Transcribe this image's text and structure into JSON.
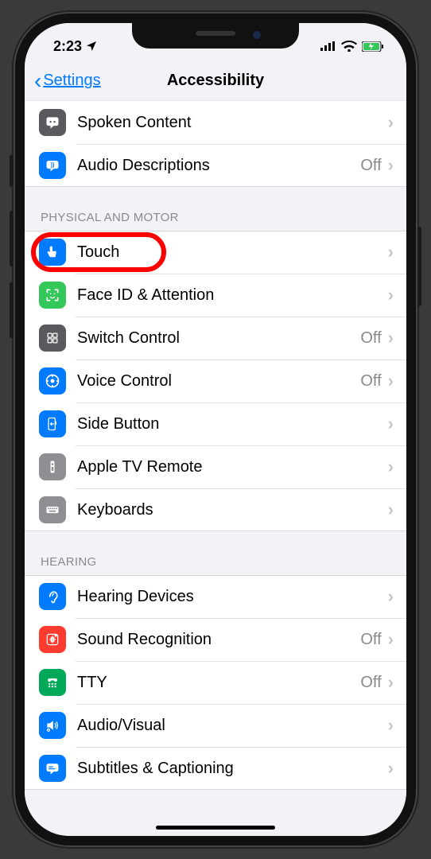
{
  "status": {
    "time": "2:23"
  },
  "nav": {
    "back": "Settings",
    "title": "Accessibility"
  },
  "sections": [
    {
      "header": null,
      "rows": [
        {
          "icon": "speech-icon",
          "bg": "bg-gray-dark",
          "label": "Spoken Content",
          "value": ""
        },
        {
          "icon": "audio-desc-icon",
          "bg": "bg-blue",
          "label": "Audio Descriptions",
          "value": "Off"
        }
      ]
    },
    {
      "header": "PHYSICAL AND MOTOR",
      "rows": [
        {
          "icon": "touch-icon",
          "bg": "bg-blue",
          "label": "Touch",
          "value": "",
          "highlight": true
        },
        {
          "icon": "faceid-icon",
          "bg": "bg-green",
          "label": "Face ID & Attention",
          "value": ""
        },
        {
          "icon": "switch-icon",
          "bg": "bg-gray-dark",
          "label": "Switch Control",
          "value": "Off"
        },
        {
          "icon": "voice-icon",
          "bg": "bg-blue",
          "label": "Voice Control",
          "value": "Off"
        },
        {
          "icon": "sidebtn-icon",
          "bg": "bg-blue",
          "label": "Side Button",
          "value": ""
        },
        {
          "icon": "remote-icon",
          "bg": "bg-gray",
          "label": "Apple TV Remote",
          "value": ""
        },
        {
          "icon": "keyboard-icon",
          "bg": "bg-gray",
          "label": "Keyboards",
          "value": ""
        }
      ]
    },
    {
      "header": "HEARING",
      "rows": [
        {
          "icon": "ear-icon",
          "bg": "bg-blue",
          "label": "Hearing Devices",
          "value": ""
        },
        {
          "icon": "sound-icon",
          "bg": "bg-red",
          "label": "Sound Recognition",
          "value": "Off"
        },
        {
          "icon": "tty-icon",
          "bg": "bg-green-dark",
          "label": "TTY",
          "value": "Off"
        },
        {
          "icon": "av-icon",
          "bg": "bg-blue",
          "label": "Audio/Visual",
          "value": ""
        },
        {
          "icon": "subtitles-icon",
          "bg": "bg-blue",
          "label": "Subtitles & Captioning",
          "value": ""
        }
      ]
    }
  ]
}
